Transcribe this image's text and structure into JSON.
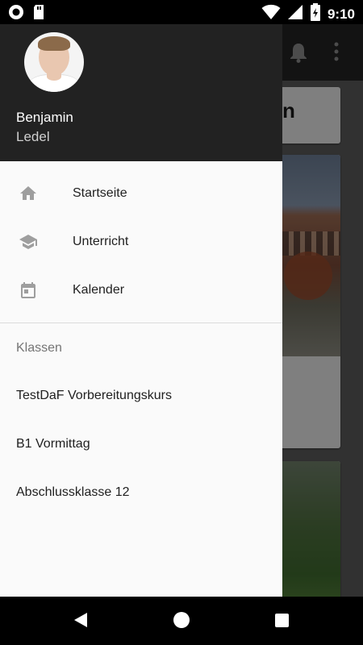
{
  "status_bar": {
    "time": "9:10"
  },
  "app_background": {
    "card_title_partial": "n"
  },
  "drawer": {
    "user": {
      "first_name": "Benjamin",
      "last_name": "Ledel"
    },
    "nav_items": [
      {
        "label": "Startseite",
        "icon": "home-icon"
      },
      {
        "label": "Unterricht",
        "icon": "school-icon"
      },
      {
        "label": "Kalender",
        "icon": "calendar-icon"
      }
    ],
    "section_title": "Klassen",
    "classes": [
      {
        "label": "TestDaF Vorbereitungskurs"
      },
      {
        "label": "B1 Vormittag"
      },
      {
        "label": "Abschlussklasse 12"
      }
    ]
  },
  "colors": {
    "drawer_header": "#222222",
    "drawer_bg": "#fafafa",
    "icon_gray": "#9e9e9e"
  }
}
